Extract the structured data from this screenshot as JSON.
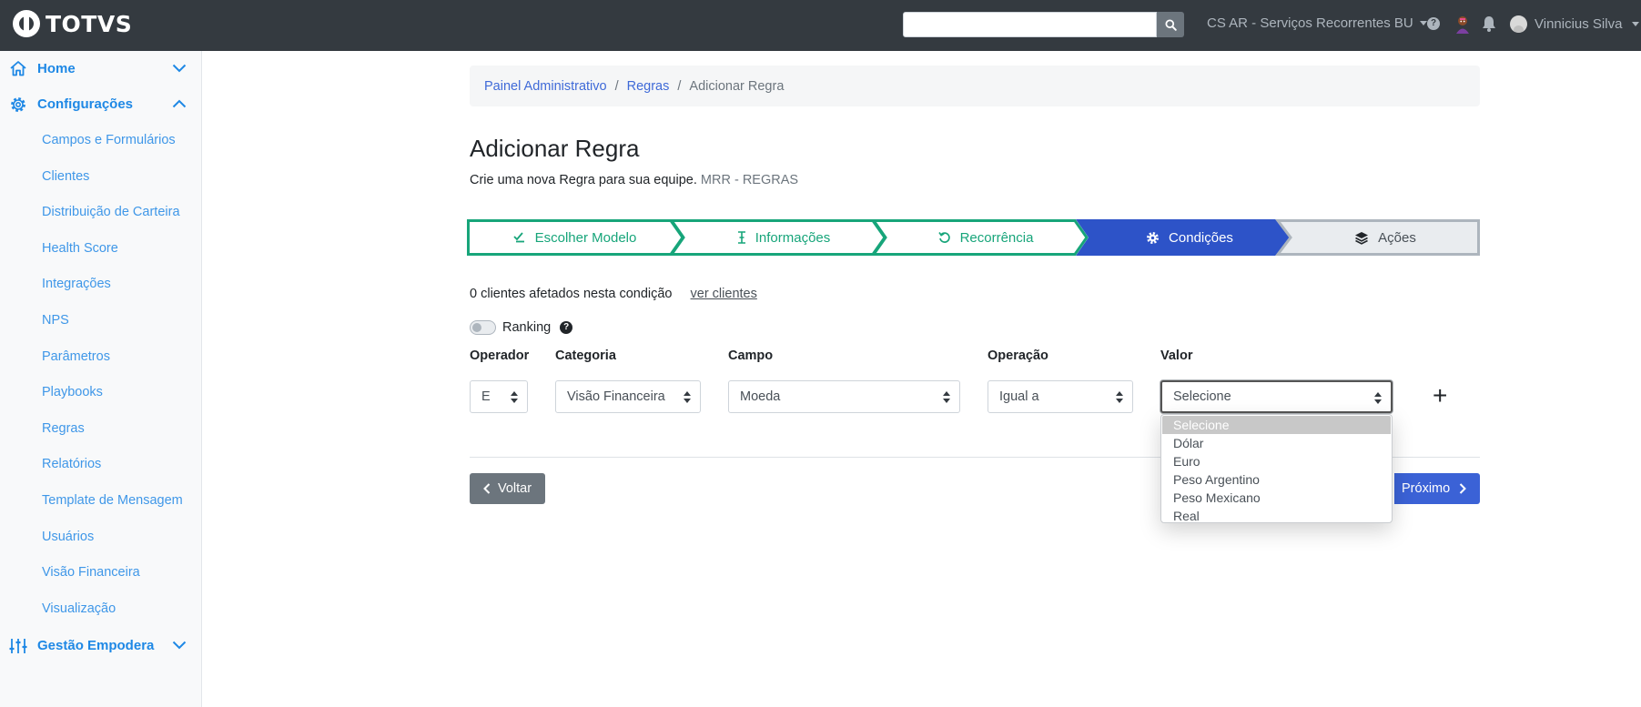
{
  "app": {
    "logo_text": "TOTVS"
  },
  "topbar": {
    "search": {
      "value": "",
      "placeholder": ""
    },
    "team": "CS AR - Serviços Recorrentes BU",
    "help": "?",
    "user_name": "Vinnicius Silva"
  },
  "sidebar": {
    "home": "Home",
    "config": "Configurações",
    "config_items": [
      "Campos e Formulários",
      "Clientes",
      "Distribuição de Carteira",
      "Health Score",
      "Integrações",
      "NPS",
      "Parâmetros",
      "Playbooks",
      "Regras",
      "Relatórios",
      "Template de Mensagem",
      "Usuários",
      "Visão Financeira",
      "Visualização"
    ],
    "gestao": "Gestão Empodera"
  },
  "breadcrumb": {
    "items": [
      "Painel Administrativo",
      "Regras"
    ],
    "separator": "/",
    "current": "Adicionar Regra"
  },
  "page": {
    "title": "Adicionar Regra",
    "subtitle": "Crie uma nova Regra para sua equipe.",
    "subtitle_tag": "MRR - REGRAS"
  },
  "stepper": {
    "steps": [
      {
        "label": "Escolher Modelo",
        "icon": "check-double-icon",
        "state": "done"
      },
      {
        "label": "Informações",
        "icon": "text-cursor-icon",
        "state": "done"
      },
      {
        "label": "Recorrência",
        "icon": "undo-icon",
        "state": "done"
      },
      {
        "label": "Condições",
        "icon": "gear-icon",
        "state": "active"
      },
      {
        "label": "Ações",
        "icon": "layers-icon",
        "state": "pending"
      }
    ],
    "colors": {
      "done": "#17a57a",
      "active": "#2d53c8",
      "pending": "#e9ecef",
      "pending_border": "#adb5bd"
    }
  },
  "conditions": {
    "affected_text": "0 clientes afetados nesta condição",
    "view_clients_link": "ver clientes",
    "ranking_label": "Ranking",
    "ranking_on": false,
    "ranking_help": "?",
    "labels": {
      "operador": "Operador",
      "categoria": "Categoria",
      "campo": "Campo",
      "operacao": "Operação",
      "valor": "Valor"
    },
    "values": {
      "operador": "E",
      "categoria": "Visão Financeira",
      "campo": "Moeda",
      "operacao": "Igual a",
      "valor": "Selecione"
    },
    "add": "+",
    "valor_options": [
      "Selecione",
      "Dólar",
      "Euro",
      "Peso Argentino",
      "Peso Mexicano",
      "Real"
    ],
    "valor_highlighted": "Selecione"
  },
  "footer": {
    "back": "Voltar",
    "next": "Próximo"
  }
}
